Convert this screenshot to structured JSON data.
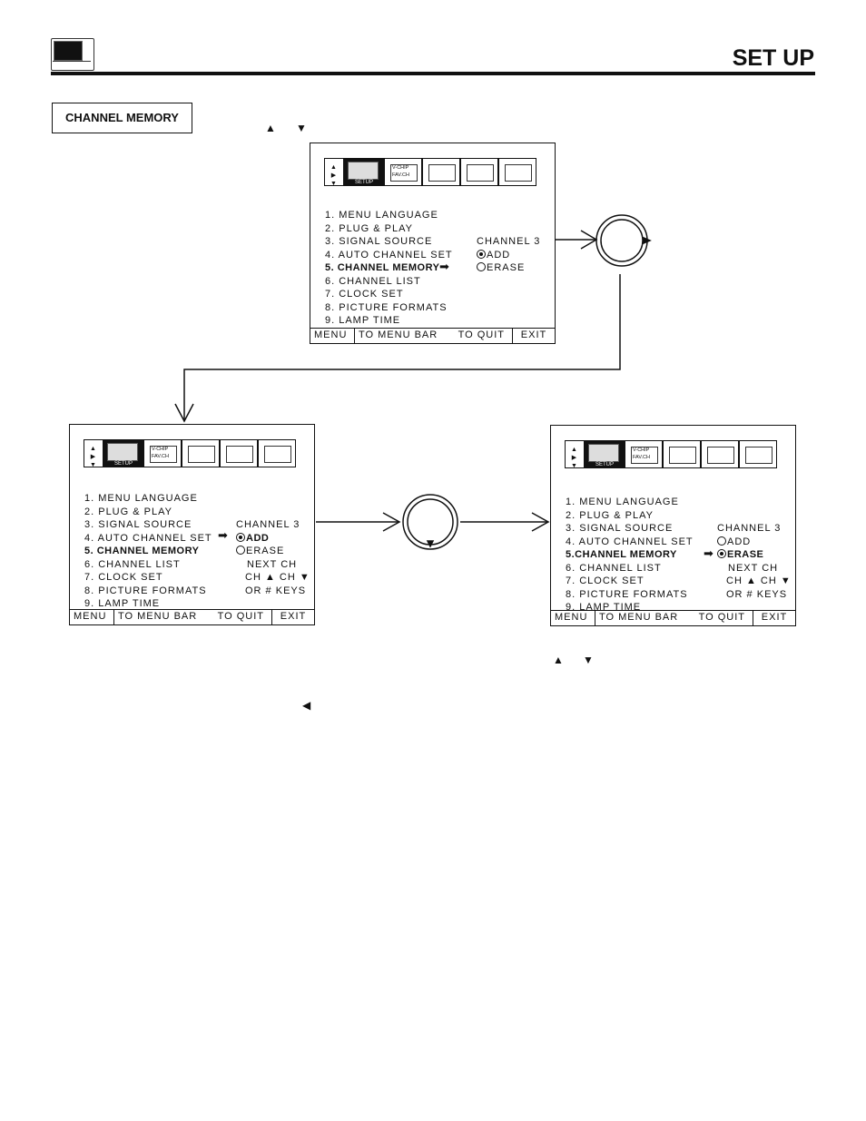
{
  "header": {
    "title": "SET UP",
    "icon": "tv-setup-icon"
  },
  "section_label": "CHANNEL MEMORY",
  "glyphs": {
    "up": "▲",
    "down": "▼",
    "left": "◀"
  },
  "menu_items": [
    "1. MENU LANGUAGE",
    "2. PLUG & PLAY",
    "3. SIGNAL SOURCE",
    "4. AUTO CHANNEL SET",
    "5. CHANNEL MEMORY",
    "6. CHANNEL LIST",
    "7. CLOCK SET",
    "8. PICTURE FORMATS",
    "9. LAMP TIME"
  ],
  "menu_item5_alt": "5.CHANNEL MEMORY",
  "iconbar": {
    "setup_label": "SETUP",
    "vchip_label": "V-CHIP",
    "ch_label": "FAV.CH"
  },
  "footer": [
    "MENU",
    "TO MENU BAR",
    "TO QUIT",
    "EXIT"
  ],
  "options": {
    "channel": "CHANNEL 3",
    "add": "ADD",
    "erase": "ERASE",
    "next": "NEXT CH",
    "ch_keys": "CH ▲  CH ▼",
    "or_keys": "OR # KEYS",
    "pointer": "➡"
  },
  "screens": [
    {
      "state": "CHANNEL MEMORY highlighted, ADD selected"
    },
    {
      "state": "ADD selected"
    },
    {
      "state": "ERASE selected"
    }
  ]
}
